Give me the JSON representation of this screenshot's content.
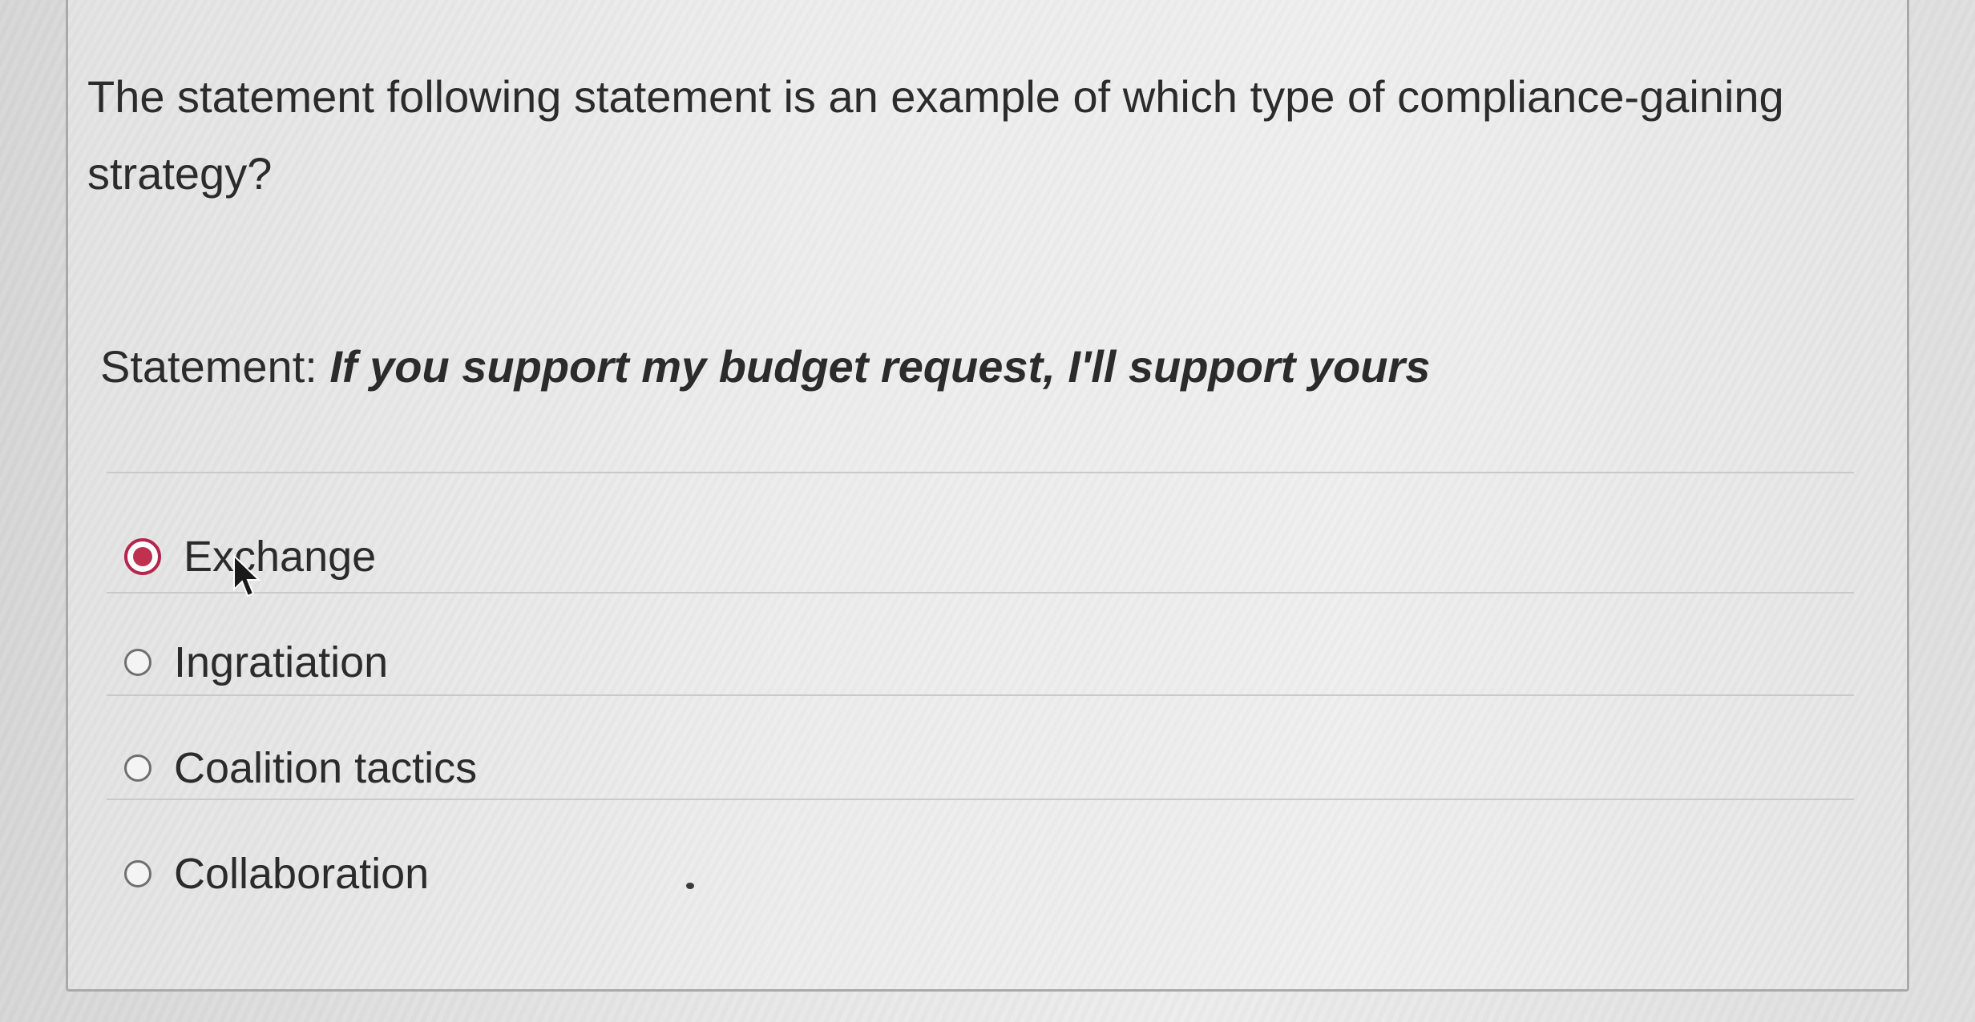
{
  "question": {
    "text": "The statement following statement is an example of which type of compliance-gaining strategy?"
  },
  "statement": {
    "label": "Statement: ",
    "quote": "If you support my budget request, I'll support yours"
  },
  "options": [
    {
      "label": "Exchange",
      "selected": true
    },
    {
      "label": "Ingratiation",
      "selected": false
    },
    {
      "label": "Coalition tactics",
      "selected": false
    },
    {
      "label": "Collaboration",
      "selected": false
    }
  ],
  "colors": {
    "selected_radio": "#c0304f",
    "text": "#2b2b2b",
    "card_border": "#a9a9a9"
  }
}
